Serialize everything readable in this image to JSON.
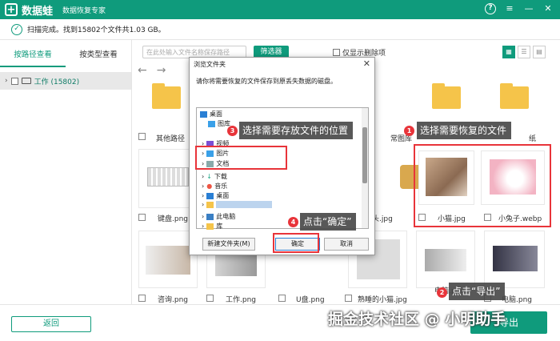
{
  "app": {
    "logo_glyph": "+",
    "name": "数据蛙",
    "subtitle": "数据恢复专家",
    "accent": "#0f9b7c"
  },
  "window": {
    "help": "?",
    "menu": "≡",
    "minimize": "—",
    "close": "✕"
  },
  "status": {
    "text": "扫描完成。找到15802个文件共1.03 GB。"
  },
  "sidebar": {
    "tabs": [
      {
        "label": "按路径查看",
        "active": true
      },
      {
        "label": "按类型查看",
        "active": false
      }
    ],
    "tree": [
      {
        "label": "工作 (15802)"
      }
    ]
  },
  "toolbar": {
    "search_placeholder": "在此处输入文件名称保存路径",
    "filter_label": "筛选器",
    "deleted_only_label": "仅显示删除项",
    "view_modes": [
      "▦",
      "☰",
      "▤"
    ]
  },
  "nav": {
    "back": "←",
    "forward": "→"
  },
  "files": [
    {
      "name": "其他路径",
      "kind": "folder"
    },
    {
      "name": "",
      "kind": "folder"
    },
    {
      "name": "",
      "kind": "folder"
    },
    {
      "name": "常图库",
      "kind": "folder"
    },
    {
      "name": "",
      "kind": "folder"
    },
    {
      "name": "纸",
      "kind": "folder"
    },
    {
      "name": "键盘.png",
      "kind": "image"
    },
    {
      "name": "",
      "kind": "image"
    },
    {
      "name": "",
      "kind": "image"
    },
    {
      "name": "头.jpg",
      "kind": "image"
    },
    {
      "name": "小猫.jpg",
      "kind": "image"
    },
    {
      "name": "小兔子.webp",
      "kind": "image"
    },
    {
      "name": "咨询.png",
      "kind": "image"
    },
    {
      "name": "工作.png",
      "kind": "image"
    },
    {
      "name": "U盘.png",
      "kind": "image"
    },
    {
      "name": "熟睡的小猫.jpg",
      "kind": "image"
    },
    {
      "name": "电脑.png",
      "kind": "image"
    },
    {
      "name": "电脑.png",
      "kind": "image"
    }
  ],
  "dialog": {
    "title": "浏览文件夹",
    "message": "请你将需要恢复的文件保存到原丢失数据的磁盘。",
    "tree": [
      {
        "label": "桌面"
      },
      {
        "label": "图库"
      },
      {
        "label": "视频"
      },
      {
        "label": "图片"
      },
      {
        "label": "文档"
      },
      {
        "label": "下载"
      },
      {
        "label": "音乐"
      },
      {
        "label": "桌面"
      },
      {
        "label": ""
      },
      {
        "label": "此电脑"
      },
      {
        "label": "库"
      }
    ],
    "new_folder_label": "新建文件夹(M)",
    "ok_label": "确定",
    "cancel_label": "取消"
  },
  "annotations": [
    {
      "step": "1",
      "text": "选择需要恢复的文件"
    },
    {
      "step": "2",
      "text": "点击“导出”"
    },
    {
      "step": "3",
      "text": "选择需要存放文件的位置"
    },
    {
      "step": "4",
      "text": "点击“确定”"
    }
  ],
  "bottom": {
    "back_label": "返回",
    "export_label": "导出"
  },
  "watermark": {
    "text": "掘金技术社区 @ 小明助手"
  }
}
